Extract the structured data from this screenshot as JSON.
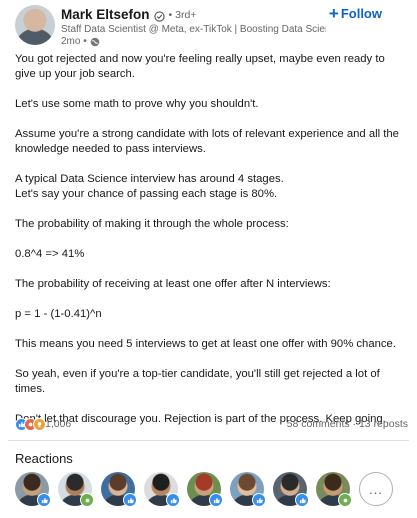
{
  "post": {
    "author": {
      "name": "Mark Eltsefon",
      "degree": "• 3rd+",
      "headline": "Staff Data Scientist @ Meta, ex-TikTok | Boosting Data Science C...",
      "timestamp": "2mo •"
    },
    "follow_label": "Follow",
    "follow_plus": "+",
    "body": [
      "You got rejected and now you're feeling really upset, maybe even ready to give up your job search.",
      "",
      "Let's use some math to prove why you shouldn't.",
      "",
      "Assume you're a strong candidate with lots of relevant experience and all the knowledge needed to pass interviews.",
      "",
      "A typical Data Science interview has around 4 stages.",
      "Let's say your chance of passing each stage is 80%.",
      "",
      "The probability of making it through the whole process:",
      "",
      "0.8^4 => 41%",
      "",
      "The probability of receiving at least one offer after N interviews:",
      "",
      "p = 1 - (1-0.41)^n",
      "",
      "This means you need 5 interviews to get at least one offer with 90% chance.",
      "",
      "So yeah, even if you're a top-tier candidate, you'll still get rejected a lot of times.",
      "",
      "Don't let that discourage you. Rejection is part of the process. Keep going."
    ],
    "social": {
      "reaction_count": "1,006",
      "comments_reposts": "58 comments · 13 reposts",
      "reaction_icons": [
        "like-icon",
        "celebrate-icon",
        "love-icon",
        "insightful-icon"
      ]
    },
    "reactions_title": "Reactions",
    "more_label": "...",
    "reactors": [
      {
        "badge": "like",
        "skin": "#c89f7c",
        "bg": "#8a9aa6",
        "hair": "#3a2a20"
      },
      {
        "badge": "celebrate",
        "skin": "#b07e5c",
        "bg": "#d5dde3",
        "hair": "#2b2b2b"
      },
      {
        "badge": "like",
        "skin": "#d9b595",
        "bg": "#3f6fa0",
        "hair": "#5a3e2a"
      },
      {
        "badge": "like",
        "skin": "#b48763",
        "bg": "#dcdcdc",
        "hair": "#1e1e1e"
      },
      {
        "badge": "like",
        "skin": "#c7a27d",
        "bg": "#6b8f4e",
        "hair": "#a33a2a"
      },
      {
        "badge": "like",
        "skin": "#e2bd9c",
        "bg": "#7d9fc0",
        "hair": "#6b4a30"
      },
      {
        "badge": "like",
        "skin": "#d3ad8d",
        "bg": "#5a6470",
        "hair": "#2a2a2a"
      },
      {
        "badge": "celebrate",
        "skin": "#c99a72",
        "bg": "#7a8a5a",
        "hair": "#3b2b1b"
      }
    ]
  }
}
